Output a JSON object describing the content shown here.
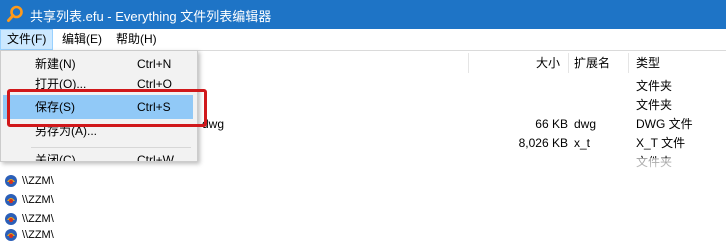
{
  "window": {
    "title": "共享列表.efu - Everything 文件列表编辑器",
    "title_bar_color": "#1e74c6"
  },
  "menubar": {
    "items": [
      {
        "label": "文件(F)",
        "active": true
      },
      {
        "label": "编辑(E)",
        "active": false
      },
      {
        "label": "帮助(H)",
        "active": false
      }
    ]
  },
  "file_menu": {
    "items": [
      {
        "label": "新建(N)",
        "shortcut": "Ctrl+N"
      },
      {
        "label": "打开(O)...",
        "shortcut": "Ctrl+O"
      },
      {
        "label": "保存(S)",
        "shortcut": "Ctrl+S",
        "highlighted": true
      },
      {
        "label": "另存为(A)...",
        "shortcut": ""
      },
      {
        "label": "关闭(C)",
        "shortcut": "Ctrl+W"
      }
    ],
    "highlight_color": "#91c9f7",
    "annotation_color": "#d0181b"
  },
  "file_list": {
    "columns": [
      "大小",
      "扩展名",
      "类型"
    ],
    "rows": [
      {
        "name": "",
        "size": "",
        "ext": "",
        "type": "文件夹"
      },
      {
        "name": "",
        "size": "",
        "ext": "",
        "type": "文件夹"
      },
      {
        "name": "dwg",
        "size": "66 KB",
        "ext": "dwg",
        "type": "DWG 文件"
      },
      {
        "name": "",
        "size": "8,026 KB",
        "ext": "x_t",
        "type": "X_T 文件"
      },
      {
        "name": "",
        "size": "",
        "ext": "",
        "type": "文件夹"
      }
    ]
  },
  "lower_rows": [
    {
      "path": "\\\\ZZM\\"
    },
    {
      "path": "\\\\ZZM\\"
    },
    {
      "path": "\\\\ZZM\\"
    },
    {
      "path": "\\\\ZZM\\"
    }
  ]
}
